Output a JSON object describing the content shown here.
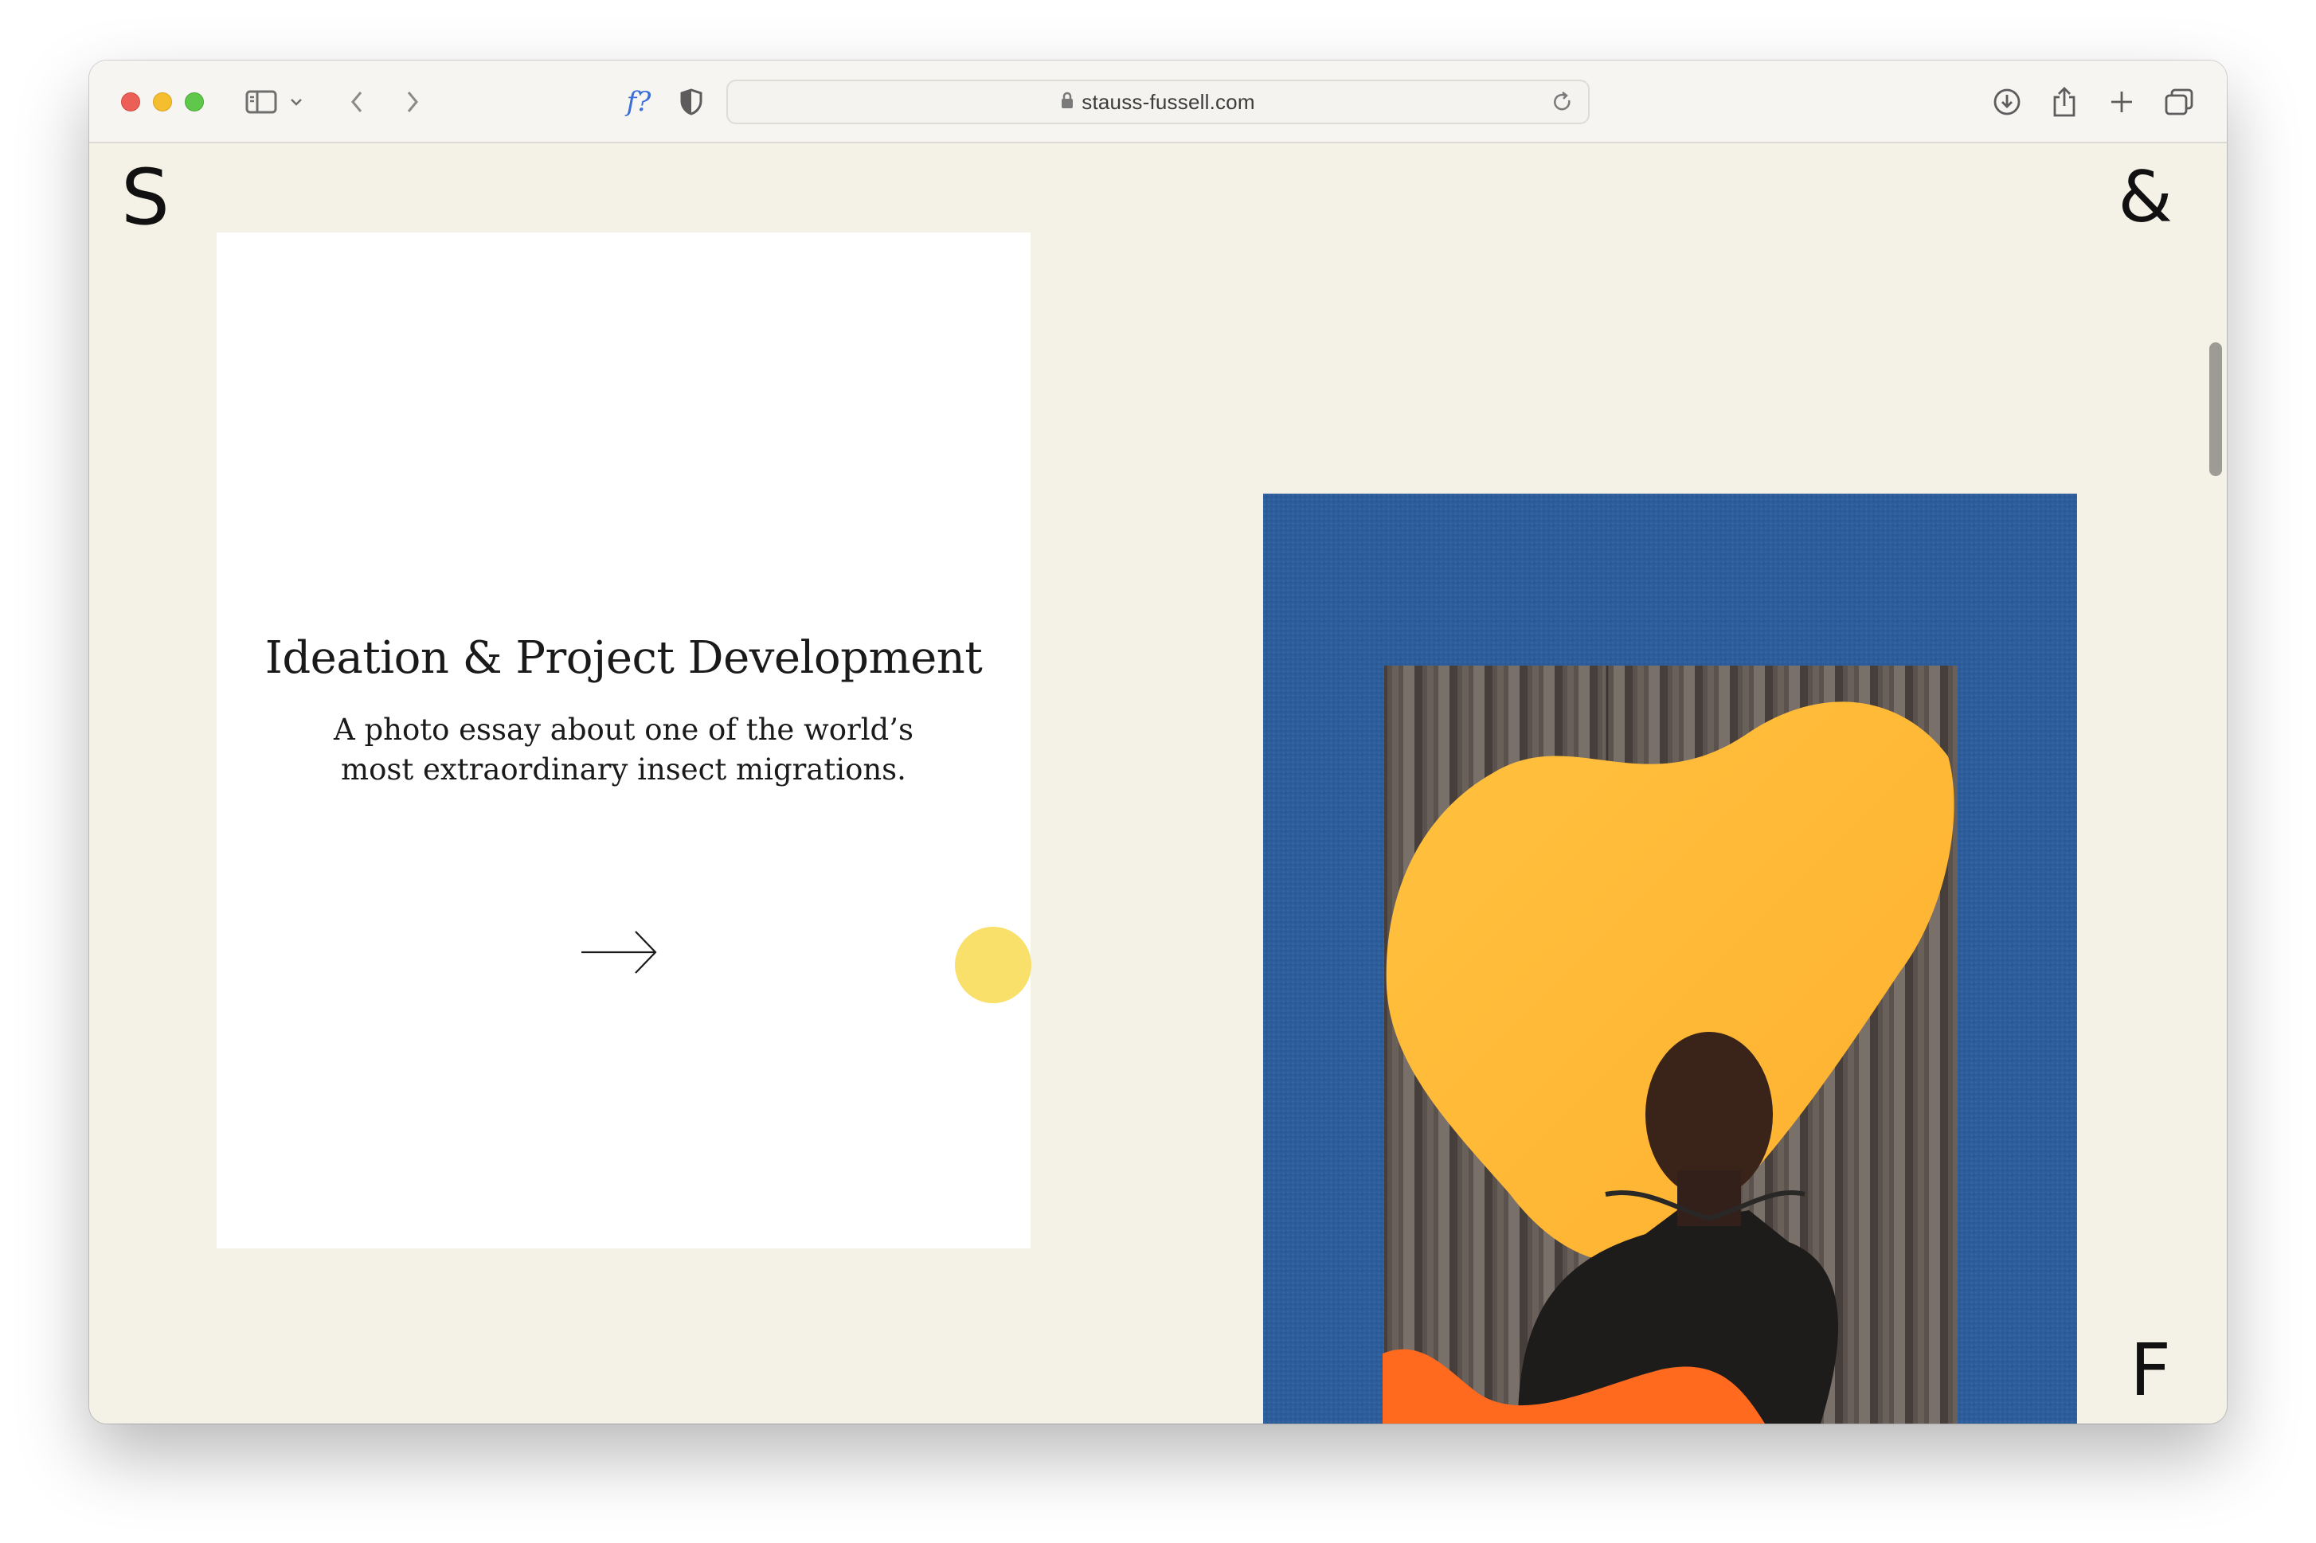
{
  "browser": {
    "url": "stauss-fussell.com",
    "icons": {
      "sidebar": "sidebar-icon",
      "back": "chevron-left-icon",
      "forward": "chevron-right-icon",
      "font_ext": "font-extension-icon",
      "privacy": "shield-icon",
      "lock": "lock-icon",
      "reload": "reload-icon",
      "download": "download-icon",
      "share": "share-icon",
      "new_tab": "plus-icon",
      "tabs": "tab-overview-icon"
    },
    "font_ext_label": "f?"
  },
  "site": {
    "logo_left": "S",
    "logo_right": "&",
    "logo_bottom": "F",
    "background_color": "#f4f1e7"
  },
  "feature": {
    "title": "Ideation & Project Development",
    "subtitle": "A photo essay about one of the world’s most extraordinary insect migrations.",
    "accent_color": "#f8e06a"
  },
  "photo": {
    "alt": "Portrait of a man in a black t-shirt in front of a yellow abstract shape on a corrugated backdrop, framed by blue felt",
    "colors": {
      "frame": "#2d5e9b",
      "shape": "#ffb83a",
      "orange": "#ff6a1f"
    }
  }
}
